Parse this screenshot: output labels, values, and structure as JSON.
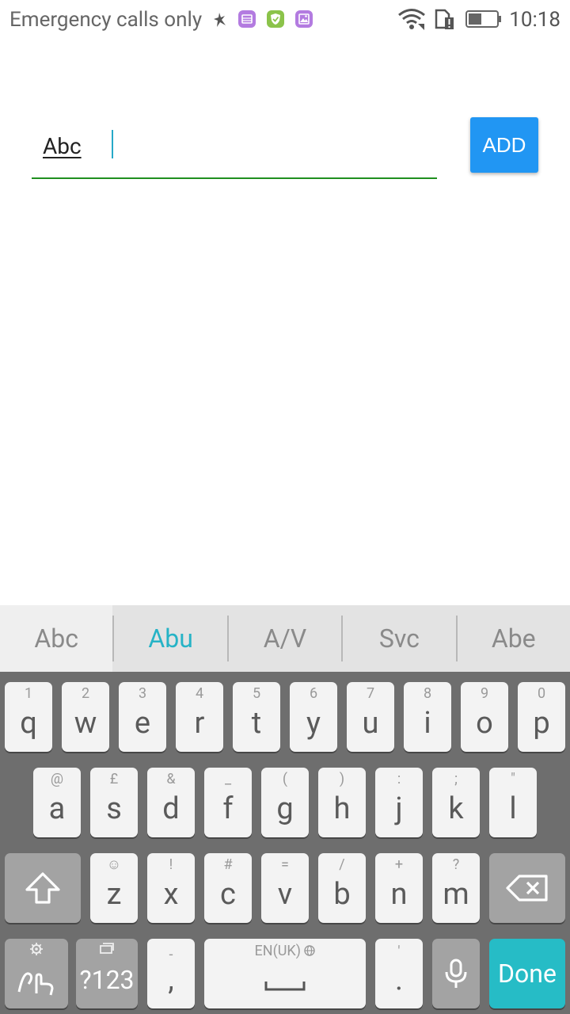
{
  "status_bar": {
    "carrier": "Emergency calls only",
    "time": "10:18",
    "icons": [
      "debug-icon",
      "notification-app-icon",
      "shield-app-icon",
      "gallery-app-icon",
      "wifi-icon",
      "sim-alert-icon",
      "battery-icon"
    ]
  },
  "form": {
    "input_value": "Abc",
    "add_label": "ADD"
  },
  "keyboard": {
    "suggestions": [
      "Abc",
      "Abu",
      "A/V",
      "Svc",
      "Abe"
    ],
    "row1": [
      {
        "main": "q",
        "sub": "1"
      },
      {
        "main": "w",
        "sub": "2"
      },
      {
        "main": "e",
        "sub": "3"
      },
      {
        "main": "r",
        "sub": "4"
      },
      {
        "main": "t",
        "sub": "5"
      },
      {
        "main": "y",
        "sub": "6"
      },
      {
        "main": "u",
        "sub": "7"
      },
      {
        "main": "i",
        "sub": "8"
      },
      {
        "main": "o",
        "sub": "9"
      },
      {
        "main": "p",
        "sub": "0"
      }
    ],
    "row2": [
      {
        "main": "a",
        "sub": "@"
      },
      {
        "main": "s",
        "sub": "£"
      },
      {
        "main": "d",
        "sub": "&"
      },
      {
        "main": "f",
        "sub": "_"
      },
      {
        "main": "g",
        "sub": "("
      },
      {
        "main": "h",
        "sub": ")"
      },
      {
        "main": "j",
        "sub": ":"
      },
      {
        "main": "k",
        "sub": ";"
      },
      {
        "main": "l",
        "sub": "\""
      }
    ],
    "row3": [
      {
        "main": "z",
        "sub": "☺"
      },
      {
        "main": "x",
        "sub": "!"
      },
      {
        "main": "c",
        "sub": "#"
      },
      {
        "main": "v",
        "sub": "="
      },
      {
        "main": "b",
        "sub": "/"
      },
      {
        "main": "n",
        "sub": "+"
      },
      {
        "main": "m",
        "sub": "?"
      }
    ],
    "symbols_label": "?123",
    "comma": {
      "main": ",",
      "sub": "-"
    },
    "space_label": "EN(UK)",
    "period": {
      "main": ".",
      "sub": "'"
    },
    "done_label": "Done"
  }
}
